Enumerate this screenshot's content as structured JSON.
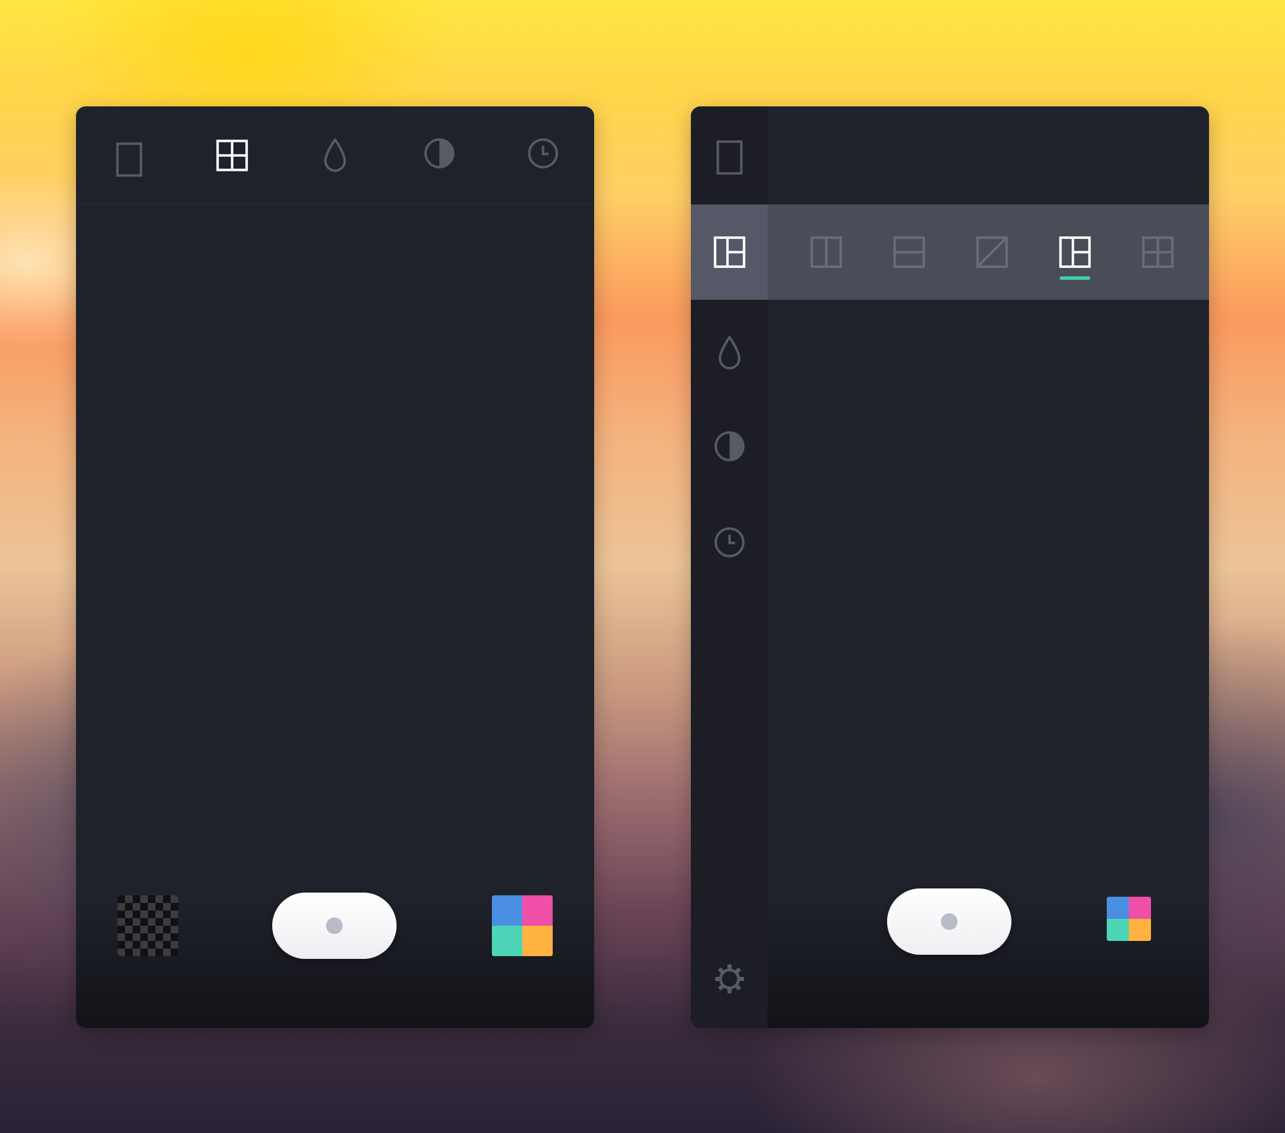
{
  "colors": {
    "accent_green": "#3ecfa6",
    "palette": [
      "#4a8fe2",
      "#ef4fa6",
      "#4dd5b8",
      "#ffb23f"
    ],
    "icon_inactive": "#585a64",
    "icon_active": "#ffffff"
  },
  "left_panel": {
    "toolbar": {
      "items": [
        {
          "icon": "portrait-frame-icon",
          "active": false
        },
        {
          "icon": "grid-2x2-icon",
          "active": true
        },
        {
          "icon": "droplet-icon",
          "active": false
        },
        {
          "icon": "contrast-icon",
          "active": false
        },
        {
          "icon": "clock-icon",
          "active": false
        }
      ]
    },
    "bottom_bar": {
      "left": "checkerboard-thumbnail",
      "center": "capture-button",
      "right": "color-palette-icon"
    }
  },
  "right_panel": {
    "sidebar": {
      "items": [
        {
          "icon": "portrait-frame-icon",
          "active": false
        },
        {
          "icon": "layout-split-icon",
          "active": true
        },
        {
          "icon": "droplet-icon",
          "active": false
        },
        {
          "icon": "contrast-icon",
          "active": false
        },
        {
          "icon": "clock-icon",
          "active": false
        },
        {
          "icon": "gear-icon",
          "active": false
        }
      ]
    },
    "layout_options": {
      "items": [
        {
          "icon": "layout-two-columns-icon",
          "selected": false
        },
        {
          "icon": "layout-two-rows-icon",
          "selected": false
        },
        {
          "icon": "layout-diagonal-icon",
          "selected": false
        },
        {
          "icon": "layout-one-plus-two-icon",
          "selected": true
        },
        {
          "icon": "layout-grid-2x2-icon",
          "selected": false
        }
      ]
    },
    "bottom_bar": {
      "center": "capture-button",
      "right": "color-palette-icon"
    }
  }
}
